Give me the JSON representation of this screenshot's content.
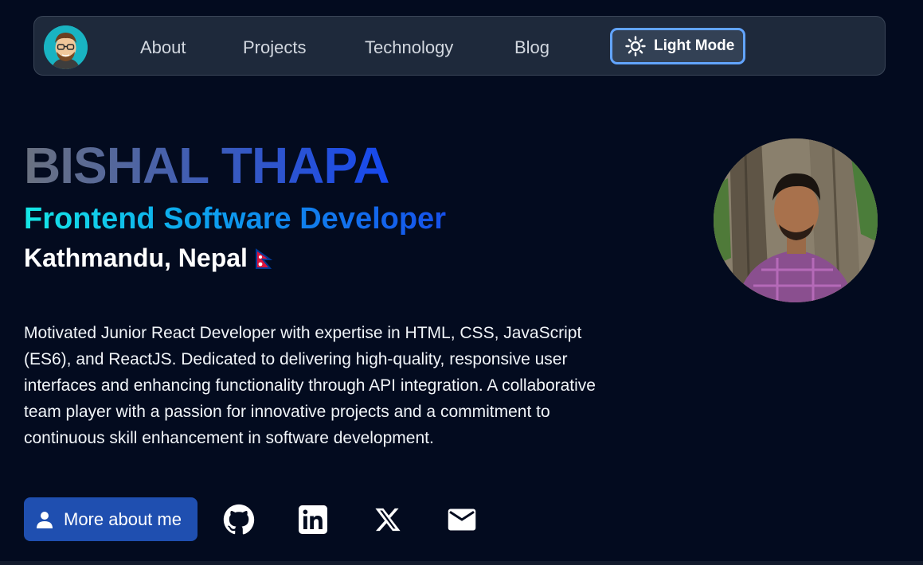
{
  "nav": {
    "links": [
      "About",
      "Projects",
      "Technology",
      "Blog"
    ],
    "theme_toggle_label": "Light Mode"
  },
  "hero": {
    "name": "BISHAL THAPA",
    "role": "Frontend Software Developer",
    "location": "Kathmandu, Nepal",
    "bio": "Motivated Junior React Developer with expertise in HTML, CSS, JavaScript (ES6), and ReactJS. Dedicated to delivering high-quality, responsive user interfaces and enhancing functionality through API integration. A collaborative team player with a passion for innovative projects and a commitment to continuous skill enhancement in software development."
  },
  "actions": {
    "more_label": "More about me",
    "social_icons": [
      "github-icon",
      "linkedin-icon",
      "x-icon",
      "mail-icon"
    ]
  },
  "colors": {
    "background": "#030b1f",
    "navbar": "#1e293b",
    "toggle_border": "#62a4ff",
    "primary_button": "#1f4fb0"
  }
}
